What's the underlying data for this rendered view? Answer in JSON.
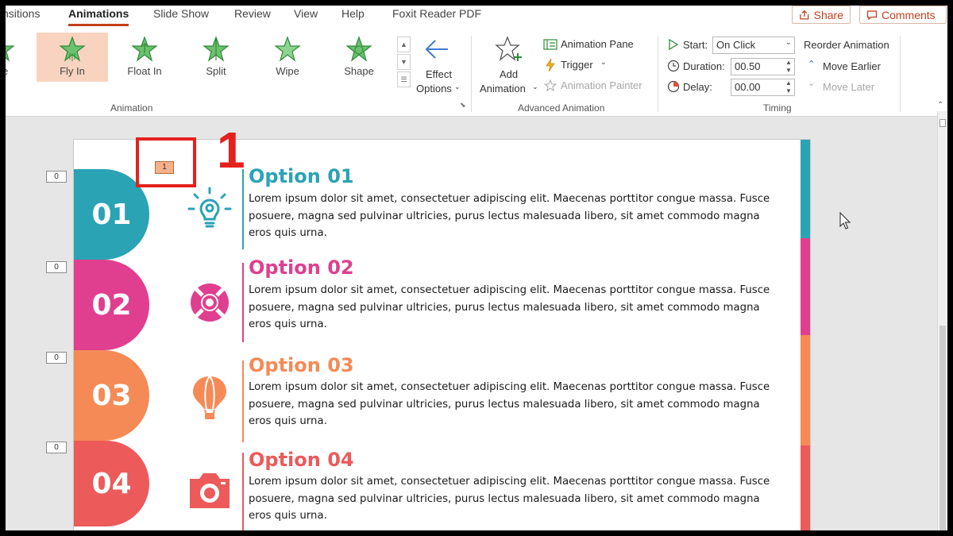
{
  "tabs": [
    {
      "label": "nsitions",
      "active": false
    },
    {
      "label": "Animations",
      "active": true
    },
    {
      "label": "Slide Show",
      "active": false
    },
    {
      "label": "Review",
      "active": false
    },
    {
      "label": "View",
      "active": false
    },
    {
      "label": "Help",
      "active": false
    },
    {
      "label": "Foxit Reader PDF",
      "active": false
    }
  ],
  "top_buttons": {
    "share": "Share",
    "comments": "Comments"
  },
  "ribbon": {
    "animation_group": {
      "items": [
        {
          "label": "e",
          "selected": false
        },
        {
          "label": "Fly In",
          "selected": true
        },
        {
          "label": "Float In",
          "selected": false
        },
        {
          "label": "Split",
          "selected": false
        },
        {
          "label": "Wipe",
          "selected": false
        },
        {
          "label": "Shape",
          "selected": false
        }
      ],
      "effect_options": [
        "Effect",
        "Options"
      ],
      "label": "Animation"
    },
    "advanced_group": {
      "add_animation": [
        "Add",
        "Animation"
      ],
      "animation_pane": "Animation Pane",
      "trigger": "Trigger",
      "animation_painter": "Animation Painter",
      "label": "Advanced Animation"
    },
    "timing_group": {
      "start_label": "Start:",
      "start_value": "On Click",
      "duration_label": "Duration:",
      "duration_value": "00.50",
      "delay_label": "Delay:",
      "delay_value": "00.00",
      "reorder": "Reorder Animation",
      "move_earlier": "Move Earlier",
      "move_later": "Move Later",
      "label": "Timing"
    }
  },
  "slide": {
    "options": [
      {
        "number": "01",
        "title": "Option 01",
        "color": "#2aa3b5",
        "icon": "lightbulb-gear-icon",
        "body": "Lorem ipsum dolor sit amet, consectetuer adipiscing elit. Maecenas porttitor congue massa. Fusce posuere, magna sed pulvinar ultricies, purus lectus malesuada libero, sit amet commodo magna eros quis urna."
      },
      {
        "number": "02",
        "title": "Option 02",
        "color": "#e03f8f",
        "icon": "lifebuoy-icon",
        "body": "Lorem ipsum dolor sit amet, consectetuer adipiscing elit. Maecenas porttitor congue massa. Fusce posuere, magna sed pulvinar ultricies, purus lectus malesuada libero, sit amet commodo magna eros quis urna."
      },
      {
        "number": "03",
        "title": "Option 03",
        "color": "#f58a56",
        "icon": "hot-air-balloon-icon",
        "body": "Lorem ipsum dolor sit amet, consectetuer adipiscing elit. Maecenas porttitor congue massa. Fusce posuere, magna sed pulvinar ultricies, purus lectus malesuada libero, sit amet commodo magna eros quis urna."
      },
      {
        "number": "04",
        "title": "Option 04",
        "color": "#ec5a5a",
        "icon": "camera-icon",
        "body": "Lorem ipsum dolor sit amet, consectetuer adipiscing elit. Maecenas porttitor congue massa. Fusce posuere, magna sed pulvinar ultricies, purus lectus malesuada libero, sit amet commodo magna eros quis urna."
      }
    ],
    "animation_tags": [
      "0",
      "0",
      "0",
      "0"
    ],
    "slide_tag": "1"
  },
  "callout": {
    "number": "1",
    "color": "#e5201d"
  }
}
